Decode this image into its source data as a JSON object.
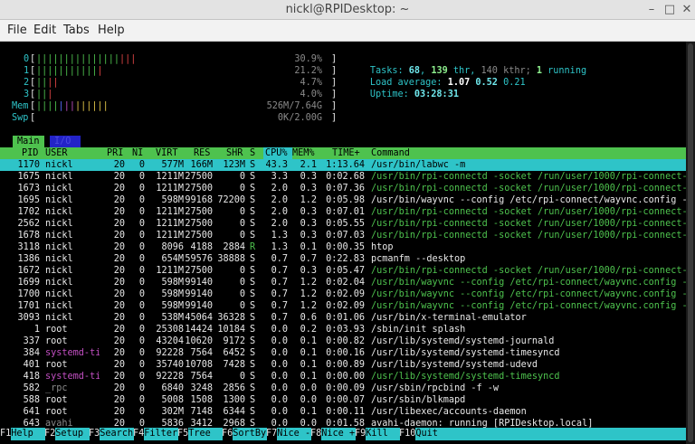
{
  "window": {
    "title": "nickl@RPIDesktop: ~",
    "minimize_glyph": "–",
    "maximize_glyph": "□",
    "close_glyph": "✕"
  },
  "menubar": {
    "items": [
      "File",
      "Edit",
      "Tabs",
      "Help"
    ]
  },
  "meters": {
    "cpus": [
      {
        "label": "0",
        "bar": "||||||||||||||||||",
        "bar_green": "|||||||||||||||",
        "bar_red": "|||",
        "percent": "30.9%"
      },
      {
        "label": "1",
        "bar": "||||||||||||",
        "bar_green": "|||||||||||",
        "bar_red": "|",
        "percent": "21.2%"
      },
      {
        "label": "2",
        "bar": "||||",
        "bar_green": "||",
        "bar_red": "||",
        "percent": "4.7%"
      },
      {
        "label": "3",
        "bar": "|||",
        "bar_green": "||",
        "bar_red": "|",
        "percent": "4.0%"
      }
    ],
    "mem": {
      "label": "Mem",
      "bar_green": "||||",
      "bar_blue": "|",
      "bar_mag": "||",
      "bar_yellow": "||||||",
      "value": "526M/7.64G"
    },
    "swp": {
      "label": "Swp",
      "value": "0K/2.00G"
    }
  },
  "summary": {
    "tasks_label": "Tasks: ",
    "tasks": "68",
    "thr": "139",
    "thr_label": " thr, ",
    "kthr": "140",
    "kthr_label": " kthr; ",
    "running": "1",
    "running_label": " running",
    "load_label": "Load average: ",
    "load1": "1.07",
    "load5": "0.52",
    "load15": "0.21",
    "uptime_label": "Uptime: ",
    "uptime": "03:28:31"
  },
  "tabs": {
    "main": "Main",
    "io": "I/O"
  },
  "columns": {
    "pid": "PID",
    "user": "USER",
    "pri": "PRI",
    "ni": "NI",
    "virt": "VIRT",
    "res": "RES",
    "shr": "SHR",
    "s": "S",
    "cpu": "CPU%",
    "mem": "MEM%",
    "time": "TIME+",
    "command": "Command"
  },
  "processes": [
    {
      "pid": "1170",
      "user": "nickl",
      "pri": "20",
      "ni": "0",
      "virt": "577M",
      "res": "166M",
      "shr": "123M",
      "s": "S",
      "cpu": "43.3",
      "mem": "2.1",
      "time": "1:13.64",
      "command": "/usr/bin/labwc -m",
      "selected": true
    },
    {
      "pid": "1675",
      "user": "nickl",
      "pri": "20",
      "ni": "0",
      "virt": "1211M",
      "res": "27500",
      "shr": "0",
      "s": "S",
      "cpu": "3.3",
      "mem": "0.3",
      "time": "0:02.68",
      "command": "/usr/bin/rpi-connectd -socket /run/user/1000/rpi-connect-",
      "thread": true
    },
    {
      "pid": "1673",
      "user": "nickl",
      "pri": "20",
      "ni": "0",
      "virt": "1211M",
      "res": "27500",
      "shr": "0",
      "s": "S",
      "cpu": "2.0",
      "mem": "0.3",
      "time": "0:07.36",
      "command": "/usr/bin/rpi-connectd -socket /run/user/1000/rpi-connect-",
      "thread": true
    },
    {
      "pid": "1695",
      "user": "nickl",
      "pri": "20",
      "ni": "0",
      "virt": "598M",
      "res": "99168",
      "shr": "72200",
      "s": "S",
      "cpu": "2.0",
      "mem": "1.2",
      "time": "0:05.98",
      "command": "/usr/bin/wayvnc --config /etc/rpi-connect/wayvnc.config -",
      "thread": false
    },
    {
      "pid": "1702",
      "user": "nickl",
      "pri": "20",
      "ni": "0",
      "virt": "1211M",
      "res": "27500",
      "shr": "0",
      "s": "S",
      "cpu": "2.0",
      "mem": "0.3",
      "time": "0:07.01",
      "command": "/usr/bin/rpi-connectd -socket /run/user/1000/rpi-connect-",
      "thread": true
    },
    {
      "pid": "2562",
      "user": "nickl",
      "pri": "20",
      "ni": "0",
      "virt": "1211M",
      "res": "27500",
      "shr": "0",
      "s": "S",
      "cpu": "2.0",
      "mem": "0.3",
      "time": "0:05.55",
      "command": "/usr/bin/rpi-connectd -socket /run/user/1000/rpi-connect-",
      "thread": true
    },
    {
      "pid": "1678",
      "user": "nickl",
      "pri": "20",
      "ni": "0",
      "virt": "1211M",
      "res": "27500",
      "shr": "0",
      "s": "S",
      "cpu": "1.3",
      "mem": "0.3",
      "time": "0:07.03",
      "command": "/usr/bin/rpi-connectd -socket /run/user/1000/rpi-connect-",
      "thread": true
    },
    {
      "pid": "3118",
      "user": "nickl",
      "pri": "20",
      "ni": "0",
      "virt": "8096",
      "res": "4188",
      "shr": "2884",
      "s": "R",
      "cpu": "1.3",
      "mem": "0.1",
      "time": "0:00.35",
      "command": "htop",
      "thread": false
    },
    {
      "pid": "1386",
      "user": "nickl",
      "pri": "20",
      "ni": "0",
      "virt": "654M",
      "res": "59576",
      "shr": "38888",
      "s": "S",
      "cpu": "0.7",
      "mem": "0.7",
      "time": "0:22.83",
      "command": "pcmanfm --desktop",
      "thread": false
    },
    {
      "pid": "1672",
      "user": "nickl",
      "pri": "20",
      "ni": "0",
      "virt": "1211M",
      "res": "27500",
      "shr": "0",
      "s": "S",
      "cpu": "0.7",
      "mem": "0.3",
      "time": "0:05.47",
      "command": "/usr/bin/rpi-connectd -socket /run/user/1000/rpi-connect-",
      "thread": true
    },
    {
      "pid": "1699",
      "user": "nickl",
      "pri": "20",
      "ni": "0",
      "virt": "598M",
      "res": "99140",
      "shr": "0",
      "s": "S",
      "cpu": "0.7",
      "mem": "1.2",
      "time": "0:02.04",
      "command": "/usr/bin/wayvnc --config /etc/rpi-connect/wayvnc.config -",
      "thread": true
    },
    {
      "pid": "1700",
      "user": "nickl",
      "pri": "20",
      "ni": "0",
      "virt": "598M",
      "res": "99140",
      "shr": "0",
      "s": "S",
      "cpu": "0.7",
      "mem": "1.2",
      "time": "0:02.09",
      "command": "/usr/bin/wayvnc --config /etc/rpi-connect/wayvnc.config -",
      "thread": true
    },
    {
      "pid": "1701",
      "user": "nickl",
      "pri": "20",
      "ni": "0",
      "virt": "598M",
      "res": "99140",
      "shr": "0",
      "s": "S",
      "cpu": "0.7",
      "mem": "1.2",
      "time": "0:02.09",
      "command": "/usr/bin/wayvnc --config /etc/rpi-connect/wayvnc.config -",
      "thread": true
    },
    {
      "pid": "3093",
      "user": "nickl",
      "pri": "20",
      "ni": "0",
      "virt": "538M",
      "res": "45064",
      "shr": "36328",
      "s": "S",
      "cpu": "0.7",
      "mem": "0.6",
      "time": "0:01.06",
      "command": "/usr/bin/x-terminal-emulator",
      "thread": false
    },
    {
      "pid": "1",
      "user": "root",
      "pri": "20",
      "ni": "0",
      "virt": "25308",
      "res": "14424",
      "shr": "10184",
      "s": "S",
      "cpu": "0.0",
      "mem": "0.2",
      "time": "0:03.93",
      "command": "/sbin/init splash",
      "thread": false
    },
    {
      "pid": "337",
      "user": "root",
      "pri": "20",
      "ni": "0",
      "virt": "43204",
      "res": "10620",
      "shr": "9172",
      "s": "S",
      "cpu": "0.0",
      "mem": "0.1",
      "time": "0:00.82",
      "command": "/usr/lib/systemd/systemd-journald",
      "thread": false
    },
    {
      "pid": "384",
      "user": "systemd-ti",
      "pri": "20",
      "ni": "0",
      "virt": "92228",
      "res": "7564",
      "shr": "6452",
      "s": "S",
      "cpu": "0.0",
      "mem": "0.1",
      "time": "0:00.16",
      "command": "/usr/lib/systemd/systemd-timesyncd",
      "thread": false,
      "user_mag": true
    },
    {
      "pid": "401",
      "user": "root",
      "pri": "20",
      "ni": "0",
      "virt": "35740",
      "res": "10708",
      "shr": "7428",
      "s": "S",
      "cpu": "0.0",
      "mem": "0.1",
      "time": "0:00.89",
      "command": "/usr/lib/systemd/systemd-udevd",
      "thread": false
    },
    {
      "pid": "418",
      "user": "systemd-ti",
      "pri": "20",
      "ni": "0",
      "virt": "92228",
      "res": "7564",
      "shr": "0",
      "s": "S",
      "cpu": "0.0",
      "mem": "0.1",
      "time": "0:00.00",
      "command": "/usr/lib/systemd/systemd-timesyncd",
      "thread": true,
      "user_mag": true
    },
    {
      "pid": "582",
      "user": "_rpc",
      "pri": "20",
      "ni": "0",
      "virt": "6840",
      "res": "3248",
      "shr": "2856",
      "s": "S",
      "cpu": "0.0",
      "mem": "0.0",
      "time": "0:00.09",
      "command": "/usr/sbin/rpcbind -f -w",
      "thread": false,
      "user_gray": true
    },
    {
      "pid": "588",
      "user": "root",
      "pri": "20",
      "ni": "0",
      "virt": "5008",
      "res": "1508",
      "shr": "1300",
      "s": "S",
      "cpu": "0.0",
      "mem": "0.0",
      "time": "0:00.07",
      "command": "/usr/sbin/blkmapd",
      "thread": false
    },
    {
      "pid": "641",
      "user": "root",
      "pri": "20",
      "ni": "0",
      "virt": "302M",
      "res": "7148",
      "shr": "6344",
      "s": "S",
      "cpu": "0.0",
      "mem": "0.1",
      "time": "0:00.11",
      "command": "/usr/libexec/accounts-daemon",
      "thread": false
    },
    {
      "pid": "643",
      "user": "avahi",
      "pri": "20",
      "ni": "0",
      "virt": "5836",
      "res": "3412",
      "shr": "2968",
      "s": "S",
      "cpu": "0.0",
      "mem": "0.0",
      "time": "0:01.58",
      "command": "avahi-daemon: running [RPIDesktop.local]",
      "thread": false,
      "user_gray": true
    }
  ],
  "fkeys": [
    {
      "key": "F1",
      "label": "Help  "
    },
    {
      "key": "F2",
      "label": "Setup "
    },
    {
      "key": "F3",
      "label": "Search"
    },
    {
      "key": "F4",
      "label": "Filter"
    },
    {
      "key": "F5",
      "label": "Tree  "
    },
    {
      "key": "F6",
      "label": "SortBy"
    },
    {
      "key": "F7",
      "label": "Nice -"
    },
    {
      "key": "F8",
      "label": "Nice +"
    },
    {
      "key": "F9",
      "label": "Kill  "
    },
    {
      "key": "F10",
      "label": "Quit  "
    }
  ]
}
